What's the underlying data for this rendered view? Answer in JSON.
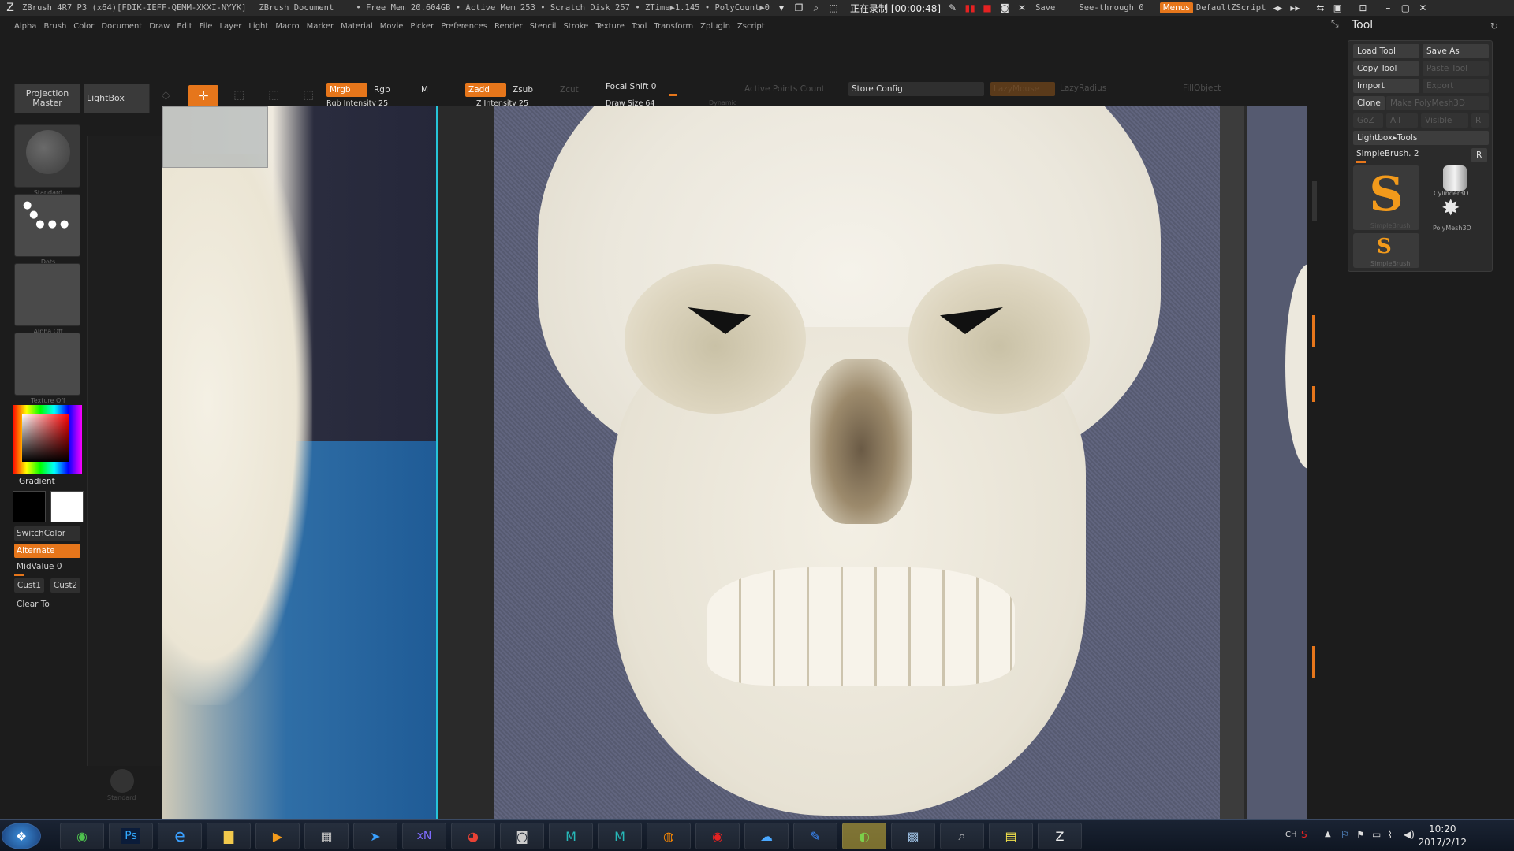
{
  "titlebar": {
    "app": "ZBrush 4R7 P3 (x64)[FDIK-IEFF-QEMM-XKXI-NYYK]",
    "doc": "ZBrush Document",
    "stats": "• Free Mem 20.604GB • Active Mem 253 • Scratch Disk 257 • ZTime▶1.145 • PolyCount▶0",
    "recording": "正在录制 [00:00:48]",
    "save": "Save",
    "seethrough": "See-through",
    "seethrough_val": "0",
    "menus": "Menus",
    "script": "DefaultZScript"
  },
  "menu": [
    "Alpha",
    "Brush",
    "Color",
    "Document",
    "Draw",
    "Edit",
    "File",
    "Layer",
    "Light",
    "Macro",
    "Marker",
    "Material",
    "Movie",
    "Picker",
    "Preferences",
    "Render",
    "Stencil",
    "Stroke",
    "Texture",
    "Tool",
    "Transform",
    "Zplugin",
    "Zscript"
  ],
  "toolbar": {
    "projection_master": "Projection Master",
    "lightbox": "LightBox",
    "mrgb": "Mrgb",
    "rgb": "Rgb",
    "m": "M",
    "rgb_intensity": "Rgb Intensity 25",
    "zadd": "Zadd",
    "zsub": "Zsub",
    "zcut": "Zcut",
    "z_intensity": "Z Intensity 25",
    "focal_shift": "Focal Shift 0",
    "draw_size": "Draw Size 64",
    "dynamic": "Dynamic",
    "active_points": "Active Points Count",
    "store_config": "Store Config",
    "lazymouse": "LazyMouse",
    "lazyradius": "LazyRadius",
    "fillobject": "FillObject"
  },
  "leftshelf": {
    "standard": "Standard",
    "dots": "Dots",
    "alpha": "Alpha Off",
    "texture": "Texture Off",
    "gradient": "Gradient",
    "switchcolor": "SwitchColor",
    "alternate": "Alternate",
    "midvalue": "MidValue 0",
    "cust1": "Cust1",
    "cust2": "Cust2",
    "clearto": "Clear To",
    "bottom_brush": "Standard"
  },
  "toolpanel": {
    "title": "Tool",
    "load": "Load Tool",
    "saveas": "Save As",
    "copy": "Copy Tool",
    "paste": "Paste Tool",
    "import": "Import",
    "export": "Export",
    "clone": "Clone",
    "makepoly": "Make PolyMesh3D",
    "goz": "GoZ",
    "all": "All",
    "visible": "Visible",
    "r": "R",
    "lightbox_tools": "Lightbox▸Tools",
    "current": "SimpleBrush. 2",
    "thumbs": [
      "SimpleBrush",
      "Cylinder3D",
      "PolyMesh3D",
      "SimpleBrush"
    ]
  },
  "taskbar": {
    "apps": [
      "start",
      "green-app",
      "Ps",
      "ie",
      "folder",
      "media",
      "calc",
      "bird",
      "xN",
      "chrome",
      "camera",
      "maya",
      "maya",
      "firefox",
      "record",
      "baidu",
      "pen",
      "globe",
      "image",
      "search",
      "notes",
      "zbrush"
    ],
    "tray_lang": "CH",
    "time": "10:20",
    "date": "2017/2/12"
  }
}
